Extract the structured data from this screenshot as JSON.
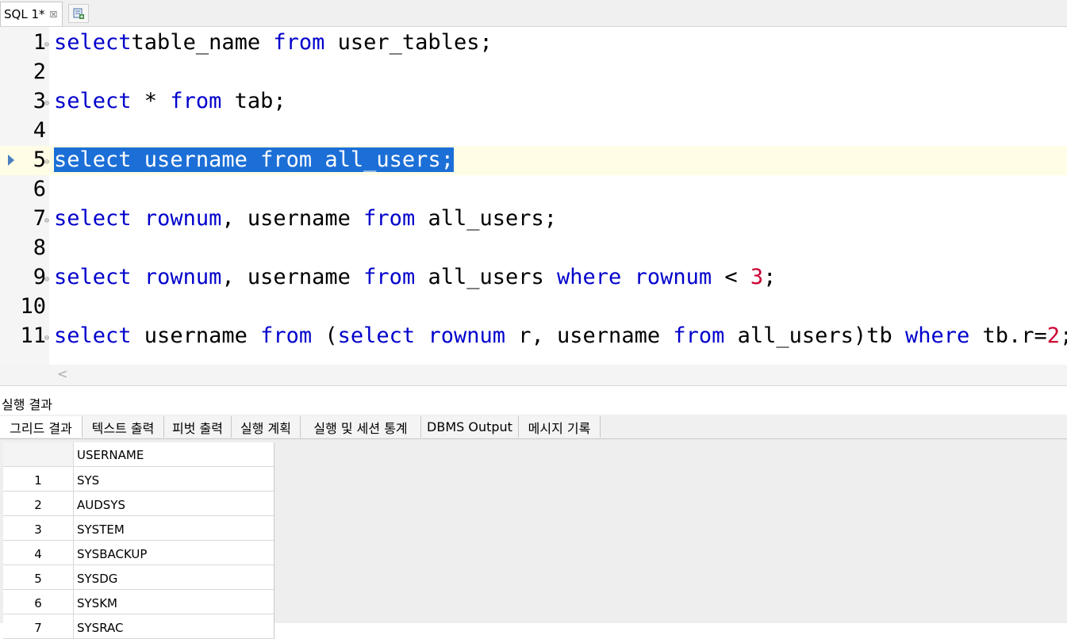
{
  "editor_tab": {
    "title": "SQL 1*",
    "close": "☒"
  },
  "editor": {
    "lines": [
      {
        "n": "1",
        "tokens": [
          [
            "kw",
            "select"
          ],
          [
            "",
            "table_name "
          ],
          [
            "kw",
            "from"
          ],
          [
            "",
            " user_tables;"
          ]
        ]
      },
      {
        "n": "2",
        "tokens": []
      },
      {
        "n": "3",
        "tokens": [
          [
            "kw",
            "select"
          ],
          [
            "",
            " * "
          ],
          [
            "kw",
            "from"
          ],
          [
            "",
            " tab;"
          ]
        ]
      },
      {
        "n": "4",
        "tokens": []
      },
      {
        "n": "5",
        "tokens": [
          [
            "kw",
            "select"
          ],
          [
            "",
            " username "
          ],
          [
            "kw",
            "from"
          ],
          [
            "",
            " all_users;"
          ]
        ]
      },
      {
        "n": "6",
        "tokens": []
      },
      {
        "n": "7",
        "tokens": [
          [
            "kw",
            "select"
          ],
          [
            "",
            " "
          ],
          [
            "kw",
            "rownum"
          ],
          [
            "",
            ", username "
          ],
          [
            "kw",
            "from"
          ],
          [
            "",
            " all_users;"
          ]
        ]
      },
      {
        "n": "8",
        "tokens": []
      },
      {
        "n": "9",
        "tokens": [
          [
            "kw",
            "select"
          ],
          [
            "",
            " "
          ],
          [
            "kw",
            "rownum"
          ],
          [
            "",
            ", username "
          ],
          [
            "kw",
            "from"
          ],
          [
            "",
            " all_users "
          ],
          [
            "kw",
            "where"
          ],
          [
            "",
            " "
          ],
          [
            "kw",
            "rownum"
          ],
          [
            "",
            " < "
          ],
          [
            "num",
            "3"
          ],
          [
            "",
            ";"
          ]
        ]
      },
      {
        "n": "10",
        "tokens": []
      },
      {
        "n": "11",
        "tokens": [
          [
            "kw",
            "select"
          ],
          [
            "",
            " username "
          ],
          [
            "kw",
            "from"
          ],
          [
            "",
            " ("
          ],
          [
            "kw",
            "select"
          ],
          [
            "",
            " "
          ],
          [
            "kw",
            "rownum"
          ],
          [
            "",
            " r, username "
          ],
          [
            "kw",
            "from"
          ],
          [
            "",
            " all_users)tb "
          ],
          [
            "kw",
            "where"
          ],
          [
            "",
            " tb.r="
          ],
          [
            "num",
            "2"
          ],
          [
            "",
            ";"
          ]
        ]
      }
    ]
  },
  "scroll": {
    "left": "<"
  },
  "results": {
    "title": "실행 결과",
    "tabs": [
      "그리드 결과",
      "텍스트 출력",
      "피벗 출력",
      "실행 계획",
      "실행 및 세션 통계",
      "DBMS Output",
      "메시지 기록"
    ],
    "column": "USERNAME",
    "rows": [
      {
        "n": "1",
        "v": "SYS"
      },
      {
        "n": "2",
        "v": "AUDSYS"
      },
      {
        "n": "3",
        "v": "SYSTEM"
      },
      {
        "n": "4",
        "v": "SYSBACKUP"
      },
      {
        "n": "5",
        "v": "SYSDG"
      },
      {
        "n": "6",
        "v": "SYSKM"
      },
      {
        "n": "7",
        "v": "SYSRAC"
      }
    ]
  }
}
